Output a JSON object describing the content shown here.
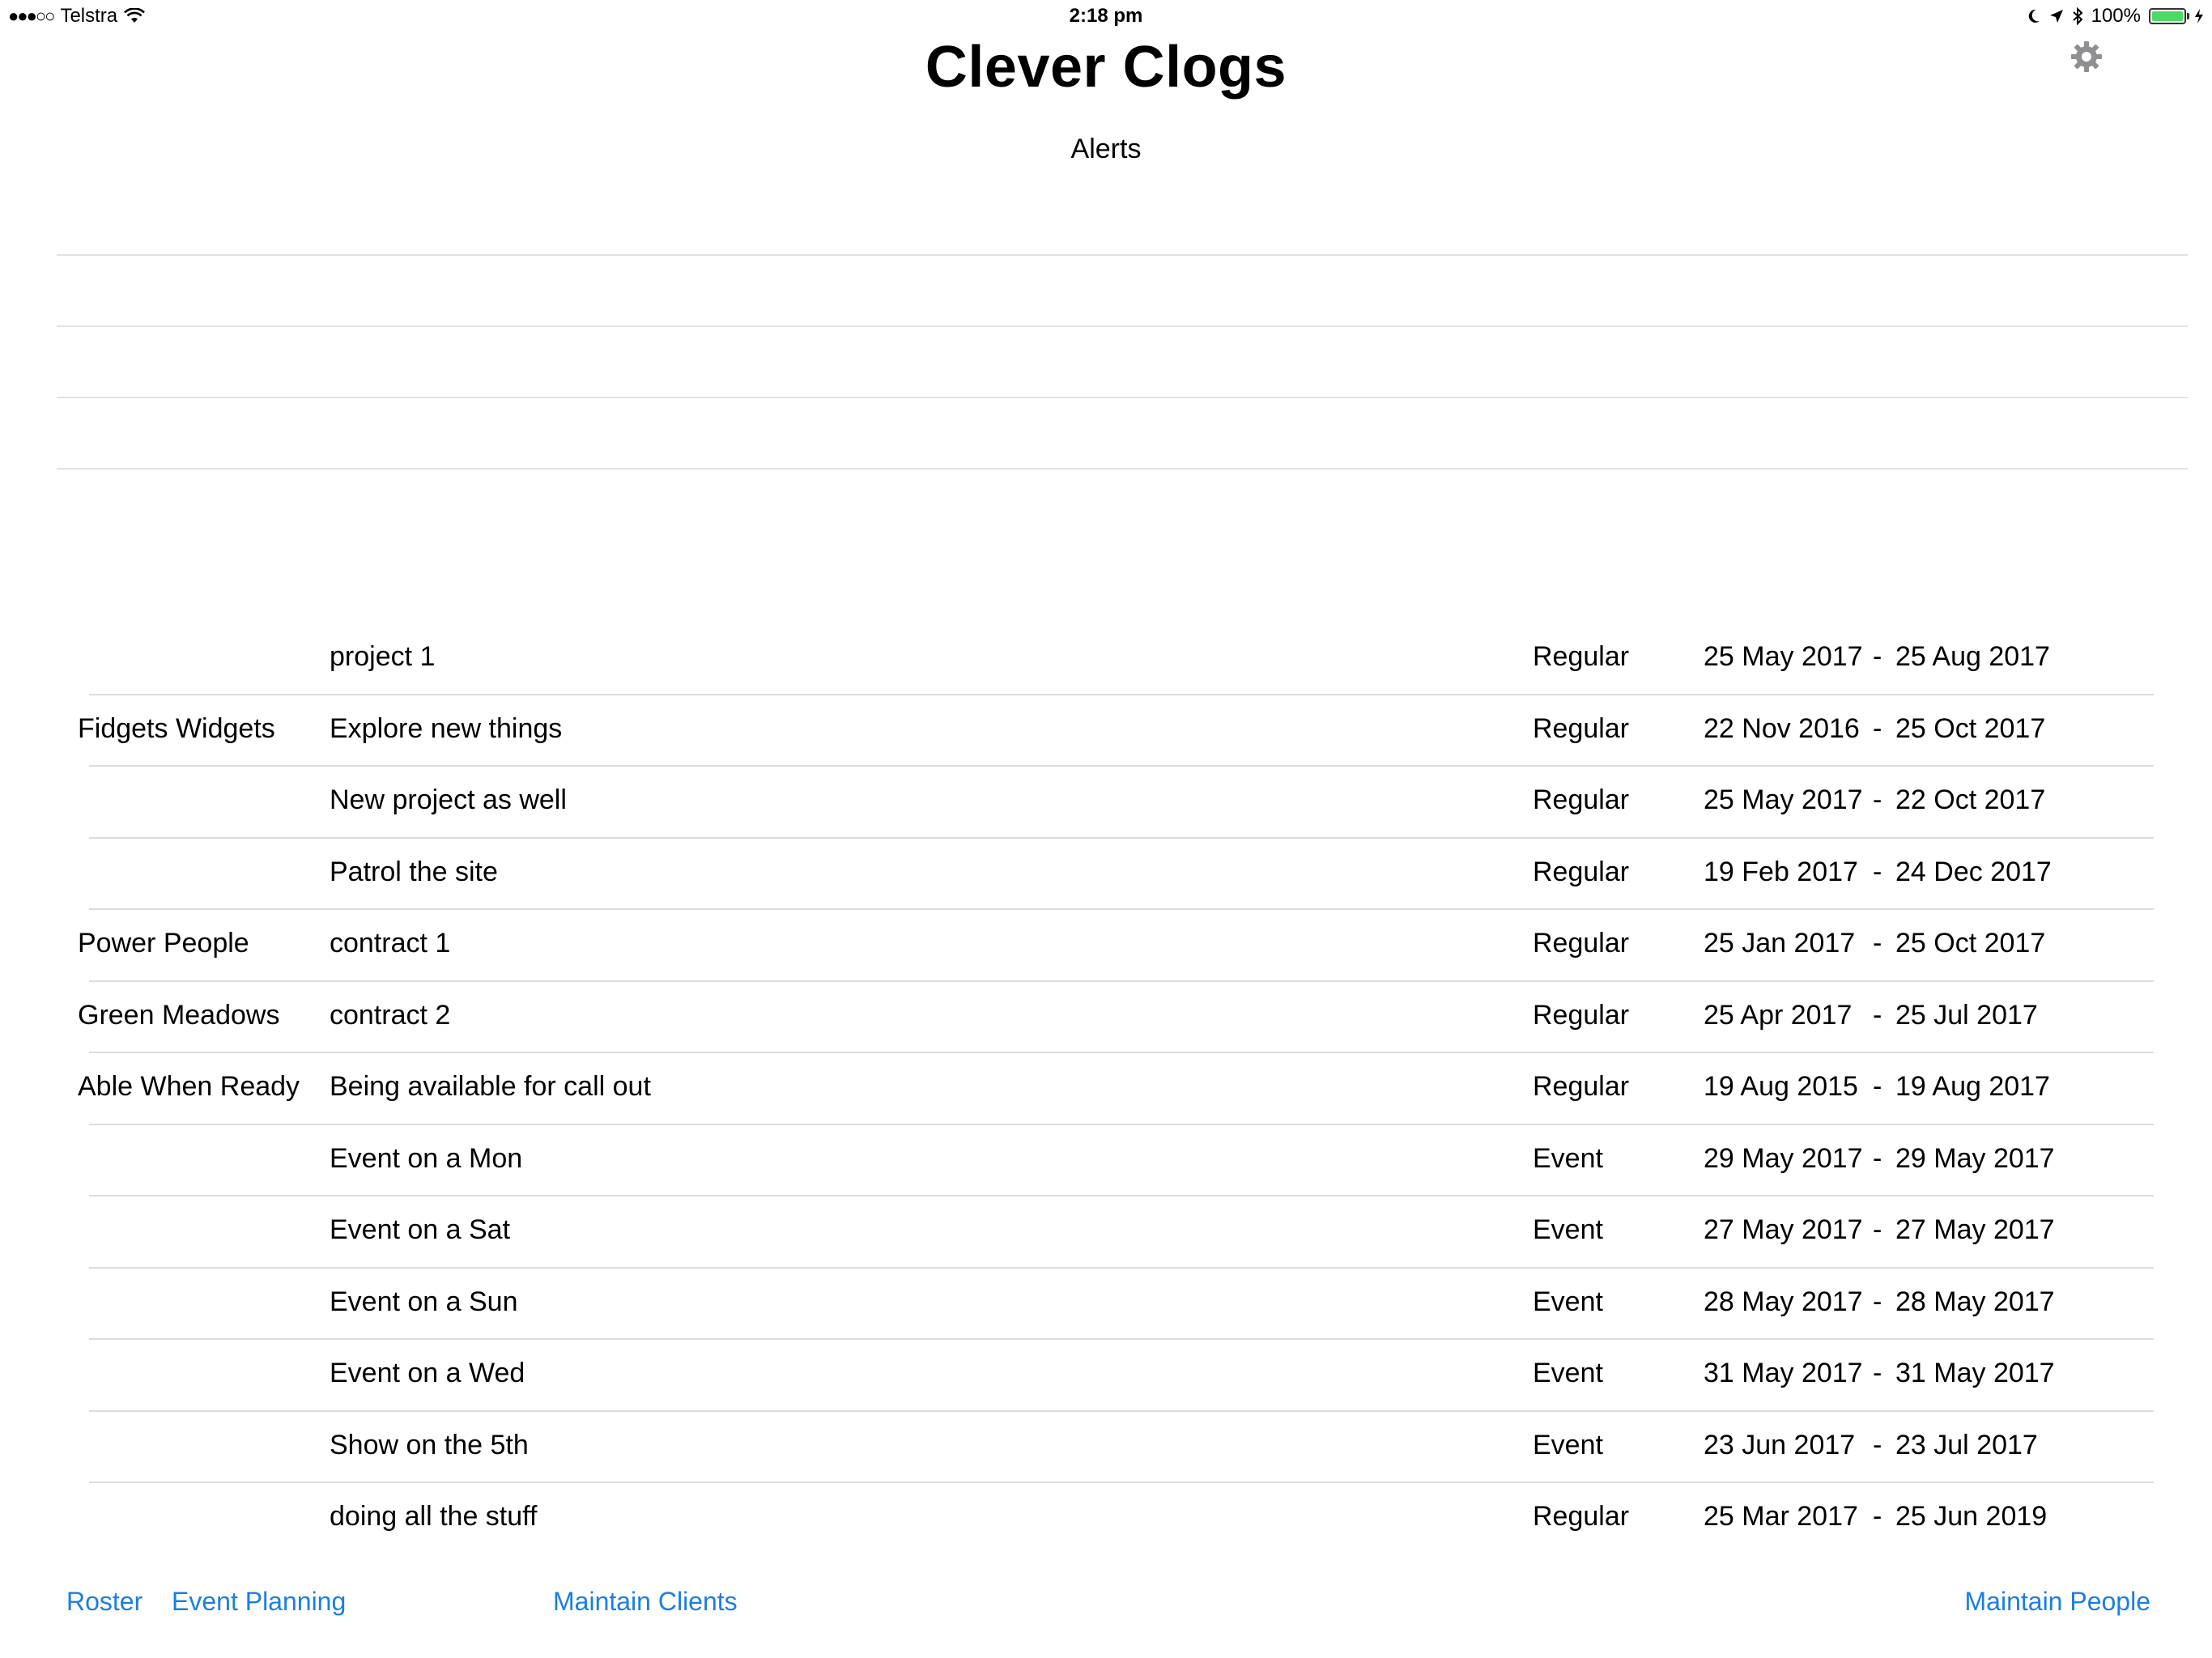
{
  "status_bar": {
    "signal": "●●●○○",
    "carrier": "Telstra",
    "time": "2:18 pm",
    "battery_text": "100%",
    "battery_level": 1.0
  },
  "header": {
    "title": "Clever Clogs",
    "subtitle": "Alerts",
    "settings_icon": "gear-icon"
  },
  "alerts": [
    {
      "text": ""
    },
    {
      "text": ""
    },
    {
      "text": ""
    }
  ],
  "contracts": [
    {
      "client": "",
      "project": "project 1",
      "type": "Regular",
      "start": "25 May 2017",
      "sep": "-",
      "end": "25 Aug 2017"
    },
    {
      "client": "Fidgets Widgets",
      "project": "Explore new things",
      "type": "Regular",
      "start": "22 Nov 2016",
      "sep": "-",
      "end": "25 Oct 2017"
    },
    {
      "client": "",
      "project": "New project as well",
      "type": "Regular",
      "start": "25 May 2017",
      "sep": "-",
      "end": "22 Oct 2017"
    },
    {
      "client": "",
      "project": "Patrol the site",
      "type": "Regular",
      "start": "19 Feb 2017",
      "sep": "-",
      "end": "24 Dec 2017"
    },
    {
      "client": "Power People",
      "project": "contract 1",
      "type": "Regular",
      "start": "25 Jan 2017",
      "sep": "-",
      "end": "25 Oct 2017"
    },
    {
      "client": "Green Meadows",
      "project": "contract 2",
      "type": "Regular",
      "start": "25 Apr 2017",
      "sep": "-",
      "end": "25 Jul 2017"
    },
    {
      "client": "Able When Ready",
      "project": "Being available for call out",
      "type": "Regular",
      "start": "19 Aug 2015",
      "sep": "-",
      "end": "19 Aug 2017"
    },
    {
      "client": "",
      "project": "Event on a Mon",
      "type": "Event",
      "start": "29 May 2017",
      "sep": "-",
      "end": "29 May 2017"
    },
    {
      "client": "",
      "project": "Event on a Sat",
      "type": "Event",
      "start": "27 May 2017",
      "sep": "-",
      "end": "27 May 2017"
    },
    {
      "client": "",
      "project": "Event on a Sun",
      "type": "Event",
      "start": "28 May 2017",
      "sep": "-",
      "end": "28 May 2017"
    },
    {
      "client": "",
      "project": "Event on a Wed",
      "type": "Event",
      "start": "31 May 2017",
      "sep": "-",
      "end": "31 May 2017"
    },
    {
      "client": "",
      "project": "Show on the 5th",
      "type": "Event",
      "start": "23 Jun 2017",
      "sep": "-",
      "end": "23 Jul 2017"
    },
    {
      "client": "",
      "project": "doing all the stuff",
      "type": "Regular",
      "start": "25 Mar 2017",
      "sep": "-",
      "end": "25 Jun 2019"
    }
  ],
  "nav": {
    "roster": "Roster",
    "event_planning": "Event Planning",
    "maintain_clients": "Maintain Clients",
    "maintain_people": "Maintain People"
  },
  "colors": {
    "link": "#1a7ee6",
    "battery": "#4cd964",
    "separator": "#dcdce0"
  }
}
